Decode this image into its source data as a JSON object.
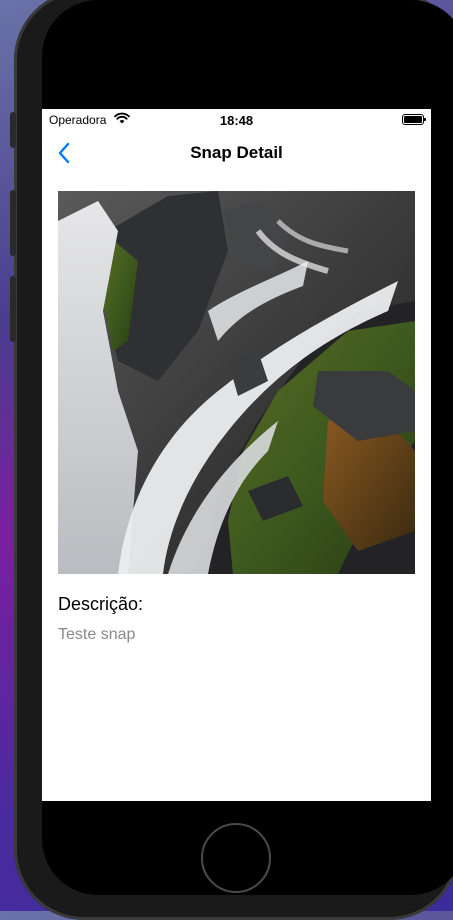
{
  "status_bar": {
    "carrier": "Operadora",
    "time": "18:48"
  },
  "navbar": {
    "title": "Snap Detail",
    "back_icon": "chevron-left-icon",
    "accent": "#007aff"
  },
  "photo": {
    "subject": "waterfall"
  },
  "detail": {
    "description_label": "Descrição:",
    "description_value": "Teste snap"
  }
}
